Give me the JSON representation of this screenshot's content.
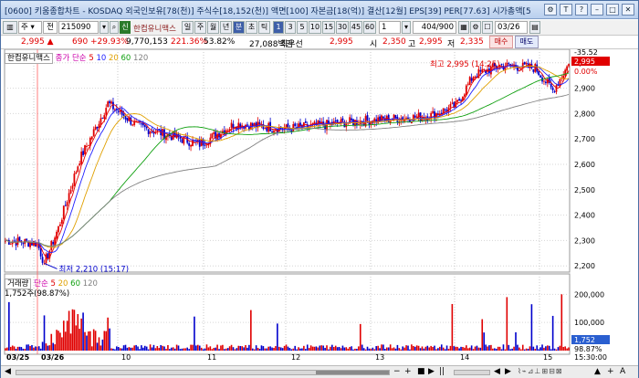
{
  "window": {
    "title": "[0600] 키움종합차트 - KOSDAQ 외국인보유[78(천)] 주식수[18,152(천)] 액면[100] 자본금[18(억)] 결산[12월] EPS[39] PER[77.63] 시가총액[5",
    "controls": [
      "⚙",
      "T",
      "?",
      "–",
      "□",
      "✕"
    ]
  },
  "toolbar": {
    "market": "주",
    "all_label": "전",
    "code": "215090",
    "credit_badge": "신",
    "stock_name": "한컴유니맥스",
    "periods": [
      "일",
      "주",
      "월",
      "년",
      "분",
      "초",
      "틱"
    ],
    "active_period": "분",
    "minutes": [
      "1",
      "3",
      "5",
      "10",
      "15",
      "30",
      "45",
      "60"
    ],
    "active_minute": "1",
    "count": "1",
    "paging": "404/900",
    "date": "03/26"
  },
  "quote": {
    "price": "2,995",
    "change": "690",
    "change_pct": "+29.93%",
    "volume": "9,770,153",
    "vol_ratio": "221.36%",
    "turnover": "53.82%",
    "amount": "27,088백만",
    "priority": "최우선",
    "ask_price": "2,995",
    "open_label": "시",
    "open": "2,350",
    "high_label": "고",
    "high": "2,995",
    "low_label": "저",
    "low": "2,335",
    "buy_button": "매수",
    "sell_button": "매도"
  },
  "colors": {
    "up": "#e00000",
    "down": "#0000cc",
    "ma5": "#e60000",
    "ma10": "#2020ff",
    "ma20": "#e0a000",
    "ma60": "#10a010",
    "ma120": "#808080"
  },
  "price_panel": {
    "legend_name": "한컴유니맥스",
    "legend_method": "종가 단순",
    "ma_labels": [
      "5",
      "10",
      "20",
      "60",
      "120"
    ],
    "high_annot": "최고 2,995 (14:25)",
    "low_annot": "최저 2,210 (15:17)",
    "right_top": [
      "-35.52",
      "2,995",
      "0.00%"
    ],
    "current_price": "2,995"
  },
  "volume_panel": {
    "legend_name": "거래량",
    "legend_method": "단순",
    "ma_labels": [
      "5",
      "20",
      "60",
      "120"
    ],
    "current_text": "1,752주(98.87%)",
    "right_badge": "1,752",
    "right_pct": "98.87%"
  },
  "x_labels": [
    "03/25",
    "03/26",
    "10",
    "11",
    "12",
    "13",
    "14",
    "15",
    "15:30:00"
  ],
  "chart_data": {
    "type": "candlestick",
    "price_axis": [
      "3,000",
      "2,900",
      "2,800",
      "2,700",
      "2,600",
      "2,500",
      "2,400",
      "2,300",
      "2,200"
    ],
    "price_ylim": [
      2190,
      3010
    ],
    "volume_axis": [
      "200,000",
      "100,000"
    ],
    "volume_ylim": [
      0,
      240000
    ],
    "bars": 320,
    "key_points": [
      {
        "t": 0,
        "price": 2300
      },
      {
        "t": 18,
        "price": 2290
      },
      {
        "t": 22,
        "price": 2210
      },
      {
        "t": 30,
        "price": 2350
      },
      {
        "t": 42,
        "price": 2620
      },
      {
        "t": 48,
        "price": 2700
      },
      {
        "t": 58,
        "price": 2840
      },
      {
        "t": 75,
        "price": 2750
      },
      {
        "t": 110,
        "price": 2680
      },
      {
        "t": 130,
        "price": 2760
      },
      {
        "t": 160,
        "price": 2740
      },
      {
        "t": 200,
        "price": 2770
      },
      {
        "t": 240,
        "price": 2790
      },
      {
        "t": 255,
        "price": 2830
      },
      {
        "t": 265,
        "price": 2950
      },
      {
        "t": 280,
        "price": 2990
      },
      {
        "t": 300,
        "price": 2980
      },
      {
        "t": 310,
        "price": 2890
      },
      {
        "t": 319,
        "price": 2995
      }
    ]
  },
  "bottom": {
    "controls": [
      "◀",
      "−",
      "+",
      "■",
      "▶",
      "||",
      "◀",
      "▶",
      "▲",
      "+",
      "A"
    ]
  }
}
